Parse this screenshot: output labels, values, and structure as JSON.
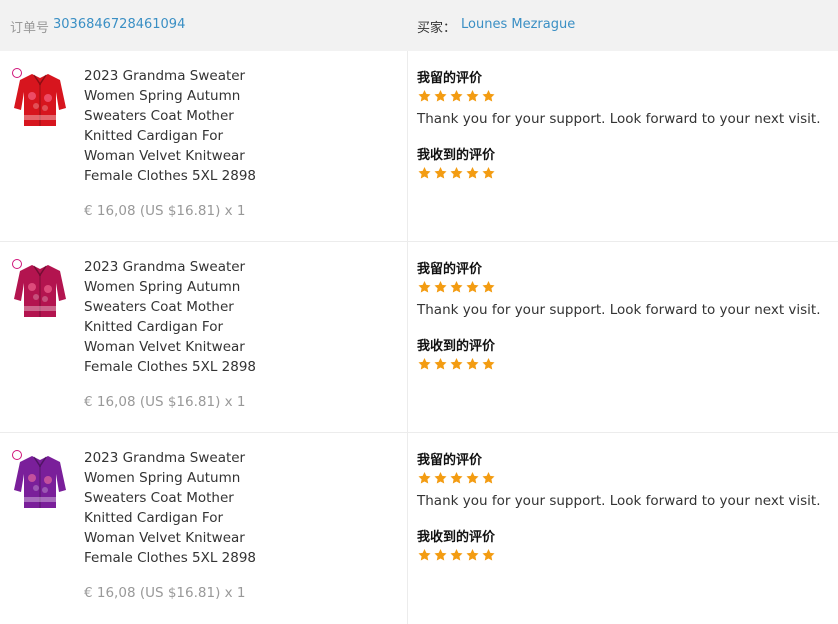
{
  "header": {
    "order_label": "订单号",
    "order_number": "3036846728461094",
    "buyer_label": "买家：",
    "buyer_name": "Lounes Mezrague"
  },
  "items": [
    {
      "title": "2023 Grandma Sweater Women Spring Autumn Sweaters Coat Mother Knitted Cardigan For Woman Velvet Knitwear Female Clothes 5XL 2898",
      "price": "€ 16,08 (US $16.81) x 1",
      "image_color": "#d7151e",
      "my_review_label": "我留的评价",
      "my_review_stars": 5,
      "my_review_text": "Thank you for your support. Look forward to your next visit.",
      "received_review_label": "我收到的评价",
      "received_review_stars": 5
    },
    {
      "title": "2023 Grandma Sweater Women Spring Autumn Sweaters Coat Mother Knitted Cardigan For Woman Velvet Knitwear Female Clothes 5XL 2898",
      "price": "€ 16,08 (US $16.81) x 1",
      "image_color": "#b3144f",
      "my_review_label": "我留的评价",
      "my_review_stars": 5,
      "my_review_text": "Thank you for your support. Look forward to your next visit.",
      "received_review_label": "我收到的评价",
      "received_review_stars": 5
    },
    {
      "title": "2023 Grandma Sweater Women Spring Autumn Sweaters Coat Mother Knitted Cardigan For Woman Velvet Knitwear Female Clothes 5XL 2898",
      "price": "€ 16,08 (US $16.81) x 1",
      "image_color": "#7a1f9a",
      "my_review_label": "我留的评价",
      "my_review_stars": 5,
      "my_review_text": "Thank you for your support. Look forward to your next visit.",
      "received_review_label": "我收到的评价",
      "received_review_stars": 5
    }
  ],
  "colors": {
    "link": "#3a8fc4",
    "star": "#f39c12",
    "header_bg": "#f2f2f2"
  }
}
